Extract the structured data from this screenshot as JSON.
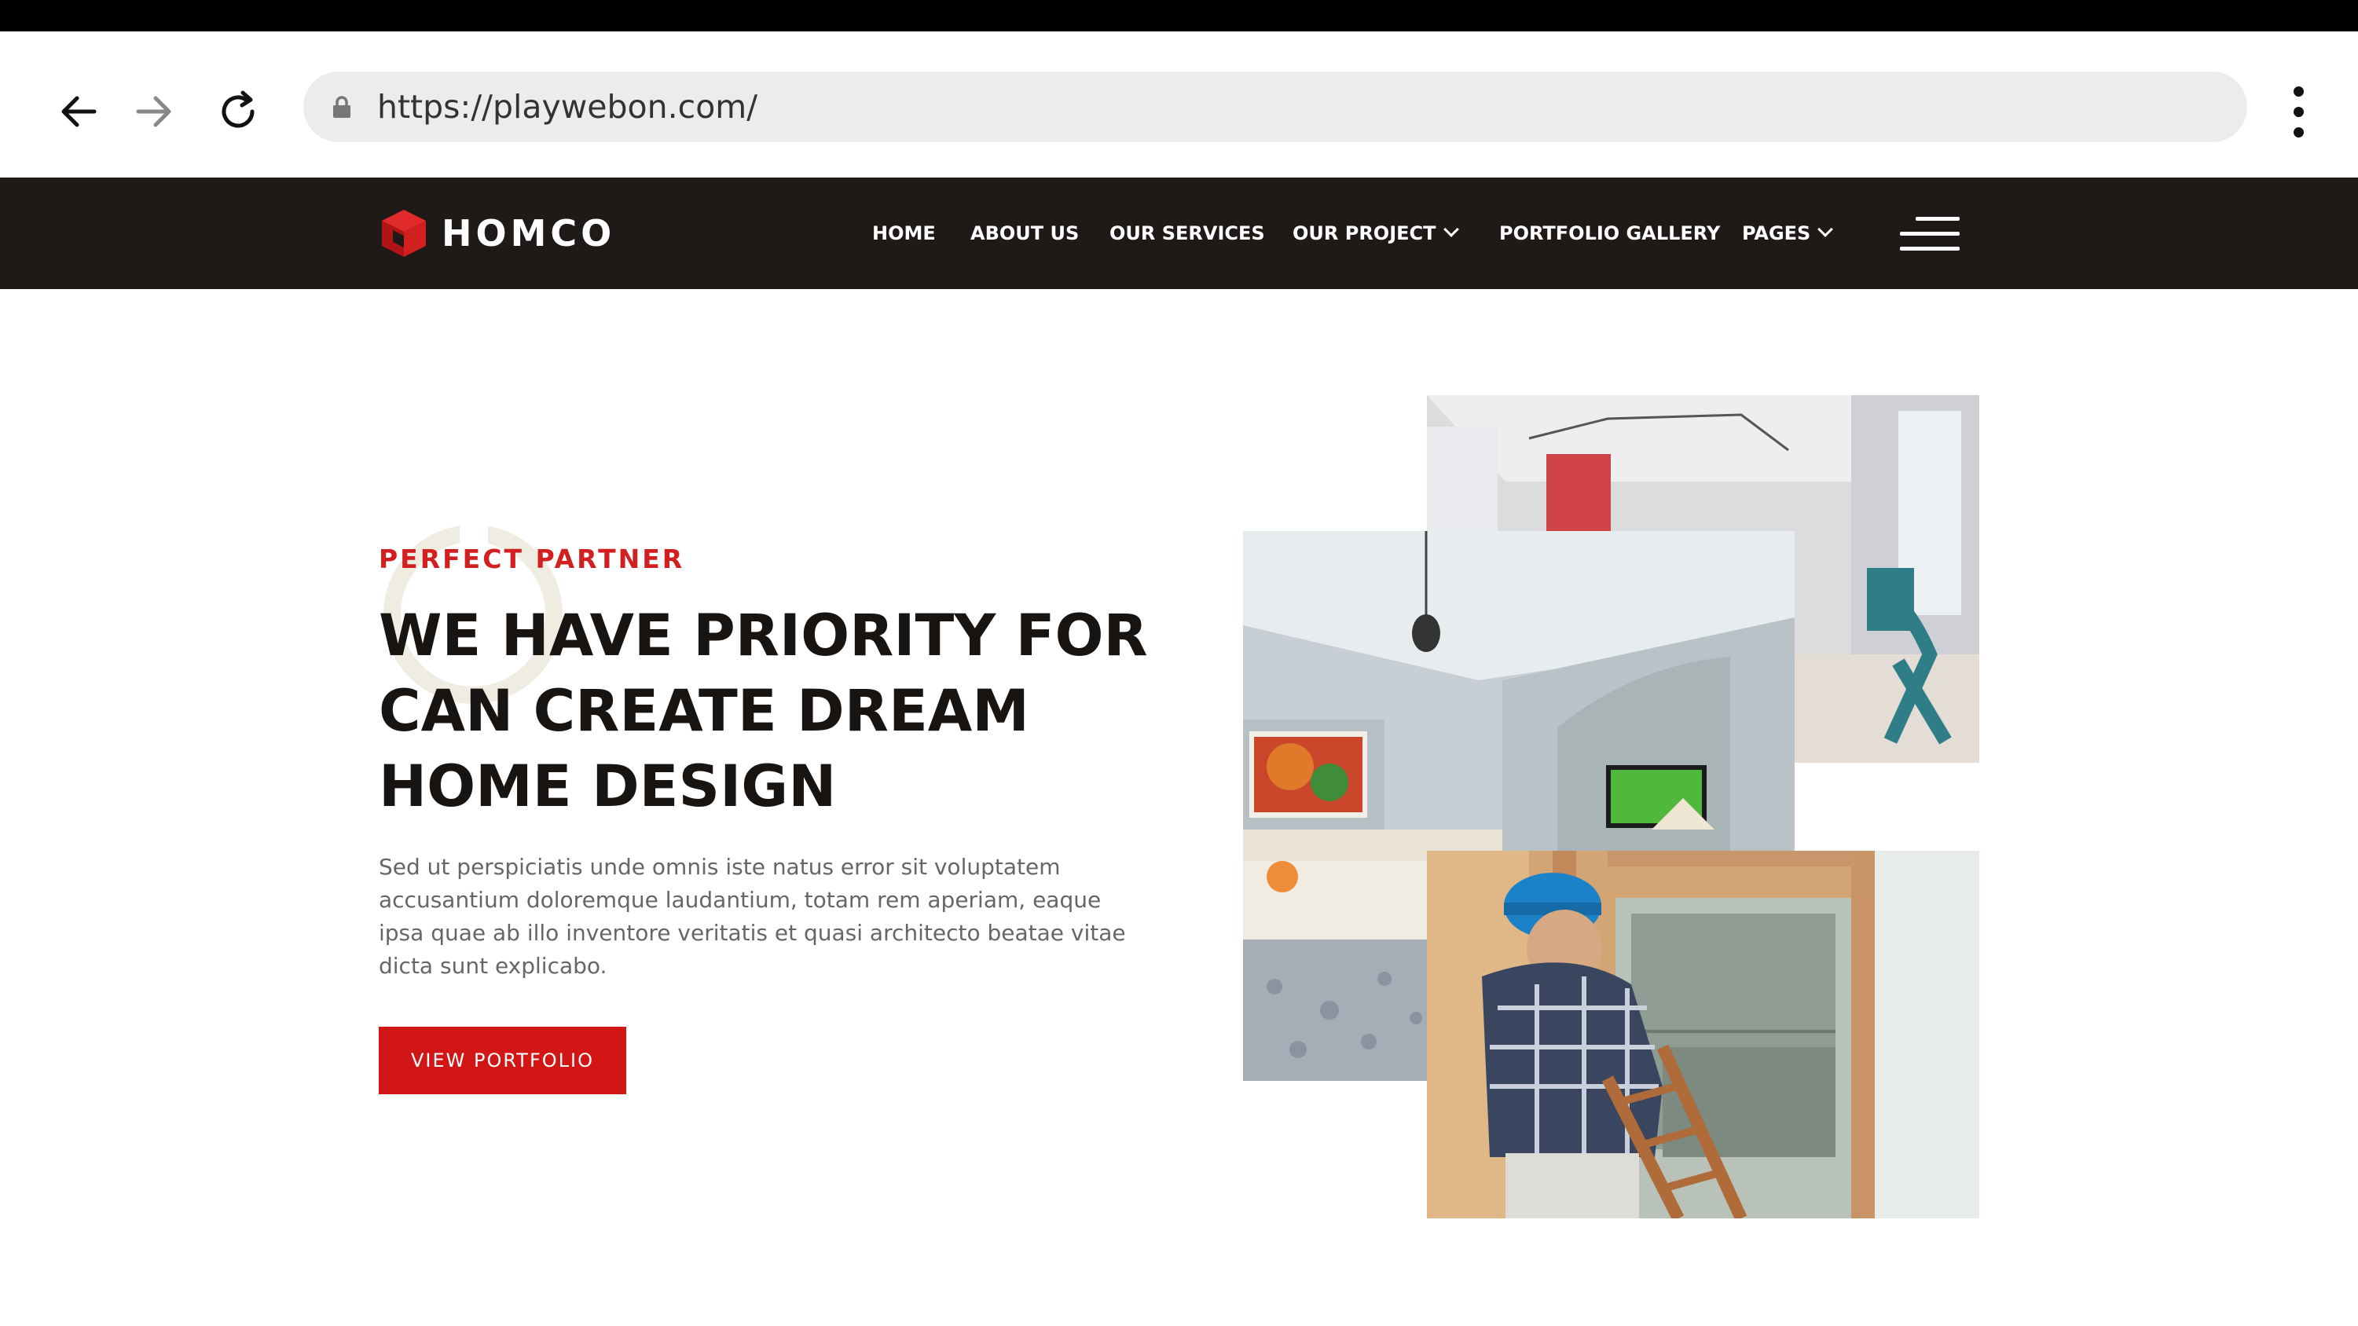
{
  "browser": {
    "url": "https://playwebon.com/",
    "icons": {
      "back": "arrow-left-icon",
      "forward": "arrow-right-icon",
      "reload": "reload-icon",
      "lock": "lock-icon",
      "menu": "kebab-menu-icon"
    }
  },
  "site": {
    "logo_text": "HOMCO",
    "nav": [
      {
        "label": "HOME",
        "dropdown": false
      },
      {
        "label": "ABOUT US",
        "dropdown": false
      },
      {
        "label": "OUR SERVICES",
        "dropdown": false
      },
      {
        "label": "OUR PROJECT",
        "dropdown": true
      },
      {
        "label": "PORTFOLIO GALLERY",
        "dropdown": false
      },
      {
        "label": "PAGES",
        "dropdown": true
      }
    ],
    "colors": {
      "header_bg": "#1f1a17",
      "accent": "#d21f1f",
      "heading": "#181412",
      "body_text": "#666666"
    }
  },
  "hero": {
    "eyebrow": "PERFECT PARTNER",
    "headline_lines": [
      "WE HAVE PRIORITY FOR",
      "CAN CREATE DREAM",
      "HOME DESIGN"
    ],
    "description": "Sed ut perspiciatis unde omnis iste natus error sit voluptatem accusantium doloremque laudantium, totam rem aperiam, eaque ipsa quae ab illo inventore veritatis et quasi architecto beatae vitae dicta sunt explicabo.",
    "cta_label": "VIEW PORTFOLIO"
  }
}
